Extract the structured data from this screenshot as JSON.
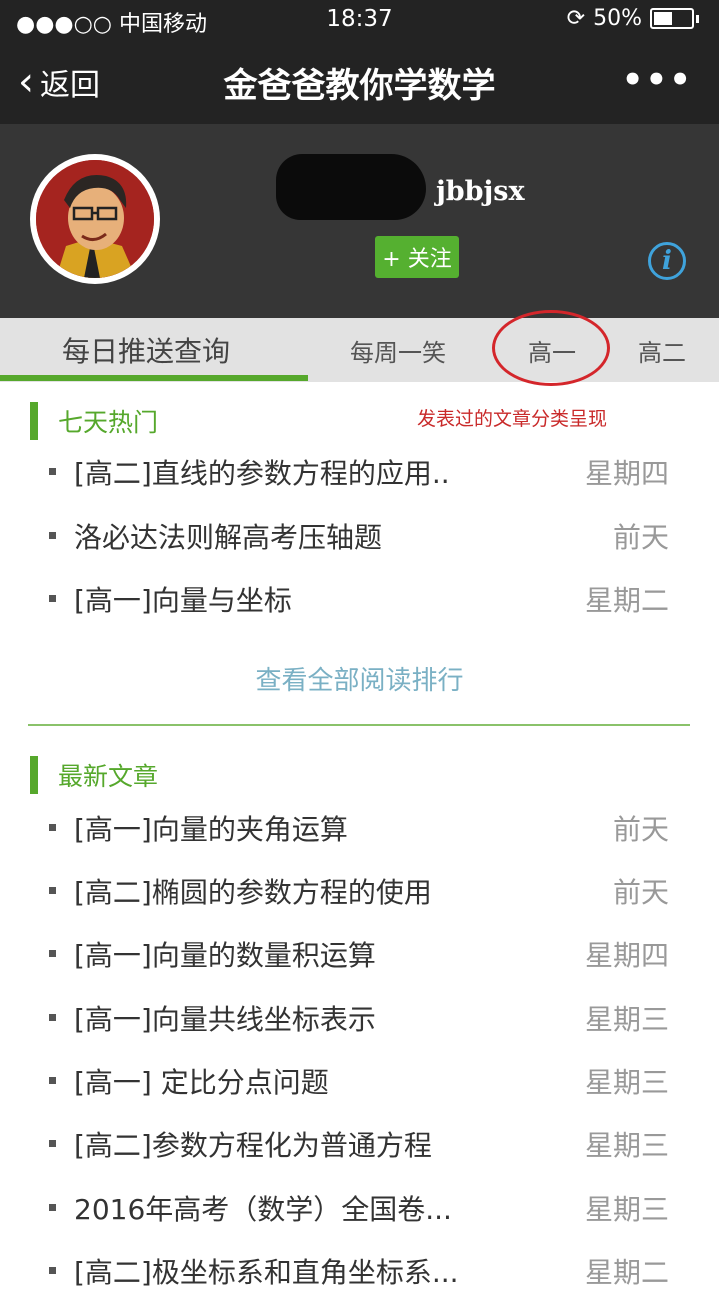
{
  "status_bar": {
    "carrier": "●●●○○ 中国移动",
    "time": "18:37",
    "battery": "50%"
  },
  "nav": {
    "back_label": "返回",
    "title": "金爸爸教你学数学",
    "more": "•••"
  },
  "profile": {
    "account_id": "jbbjsx",
    "follow_label": "+ 关注",
    "info_glyph": "i"
  },
  "tabs": [
    {
      "label": "每日推送查询",
      "active": true
    },
    {
      "label": "每周一笑",
      "active": false
    },
    {
      "label": "高一",
      "active": false
    },
    {
      "label": "高二",
      "active": false
    }
  ],
  "annotation": "发表过的文章分类呈现",
  "hot": {
    "heading": "七天热门",
    "items": [
      {
        "title": "[高二]直线的参数方程的应用..",
        "when": "星期四"
      },
      {
        "title": "洛必达法则解高考压轴题",
        "when": "前天"
      },
      {
        "title": "[高一]向量与坐标",
        "when": "星期二"
      }
    ],
    "view_all": "查看全部阅读排行"
  },
  "latest": {
    "heading": "最新文章",
    "items": [
      {
        "title": "[高一]向量的夹角运算",
        "when": "前天"
      },
      {
        "title": "[高二]椭圆的参数方程的使用",
        "when": "前天"
      },
      {
        "title": "[高一]向量的数量积运算",
        "when": "星期四"
      },
      {
        "title": "[高一]向量共线坐标表示",
        "when": "星期三"
      },
      {
        "title": "[高一] 定比分点问题",
        "when": "星期三"
      },
      {
        "title": "[高二]参数方程化为普通方程",
        "when": "星期三"
      },
      {
        "title": "2016年高考（数学）全国卷...",
        "when": "星期三"
      },
      {
        "title": "[高二]极坐标系和直角坐标系...",
        "when": "星期二"
      }
    ]
  },
  "colors": {
    "accent_green": "#56a82c",
    "annotation_red": "#d4262b",
    "info_blue": "#3fa3dc"
  }
}
